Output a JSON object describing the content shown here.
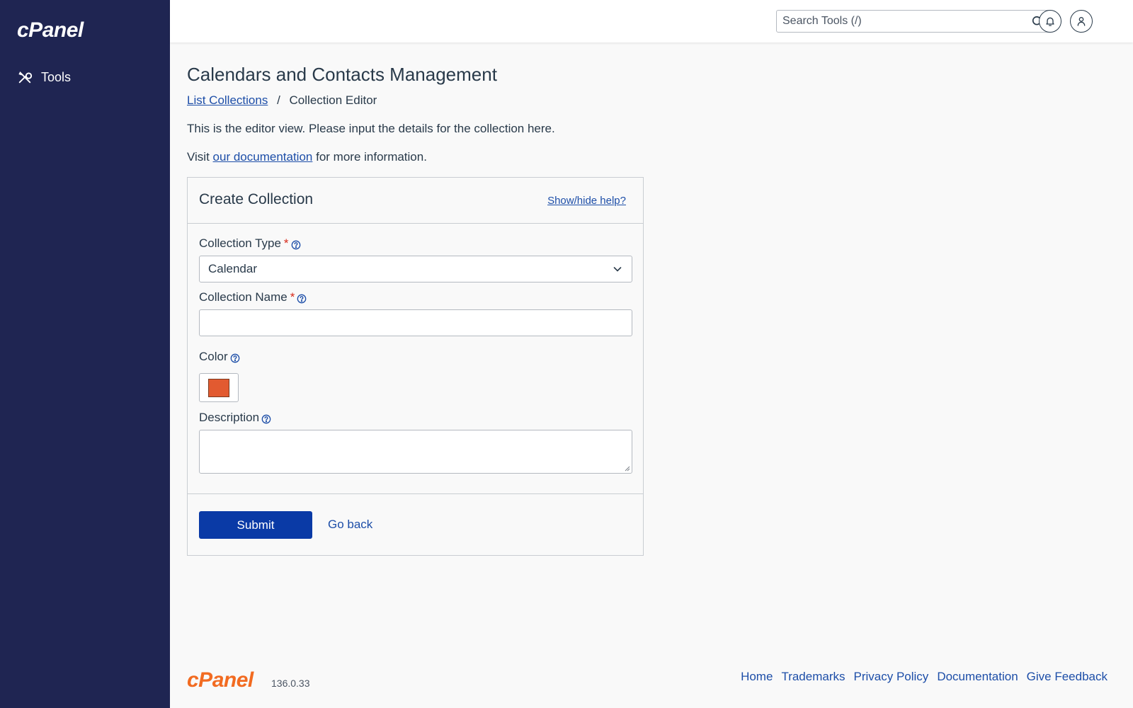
{
  "sidebar": {
    "logo_text": "cPanel",
    "nav": [
      {
        "label": "Tools",
        "icon": "tools-icon"
      }
    ]
  },
  "header": {
    "search_placeholder": "Search Tools (/)",
    "icons": [
      "search-icon",
      "bell-icon",
      "user-icon"
    ]
  },
  "page": {
    "title": "Calendars and Contacts Management",
    "breadcrumb": {
      "link": "List Collections",
      "separator": "/",
      "current": "Collection Editor"
    },
    "intro": "This is the editor view. Please input the details for the collection here.",
    "visit_prefix": "Visit",
    "visit_link": "our documentation",
    "visit_suffix": "for more information."
  },
  "form": {
    "title": "Create Collection",
    "help_link": "Show/hide help?",
    "collection_type": {
      "label": "Collection Type",
      "required_mark": "*",
      "value": "Calendar"
    },
    "collection_name": {
      "label": "Collection Name",
      "required_mark": "*",
      "value": ""
    },
    "color": {
      "label": "Color",
      "value": "#e25a30"
    },
    "description": {
      "label": "Description",
      "value": ""
    },
    "submit_label": "Submit",
    "goback_label": "Go back"
  },
  "footer": {
    "logo_text": "cPanel",
    "version": "136.0.33",
    "links": [
      "Home",
      "Trademarks",
      "Privacy Policy",
      "Documentation",
      "Give Feedback"
    ]
  },
  "colors": {
    "sidebar_bg": "#1f2552",
    "primary_button": "#0a3aa6",
    "link": "#1d4ea8",
    "brand_orange": "#f26b21",
    "required": "#d72a1a"
  }
}
